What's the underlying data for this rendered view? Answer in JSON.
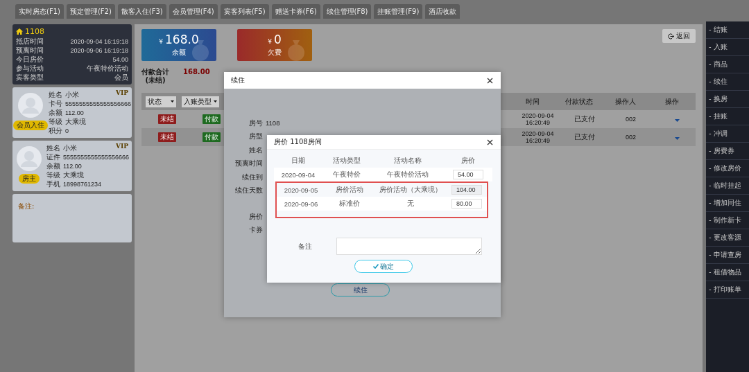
{
  "tabs": [
    {
      "label": "实时房态(F1)"
    },
    {
      "label": "预定管理(F2)"
    },
    {
      "label": "散客入住(F3)"
    },
    {
      "label": "会员管理(F4)"
    },
    {
      "label": "宾客列表(F5)"
    },
    {
      "label": "赠送卡券(F6)"
    },
    {
      "label": "续住管理(F8)"
    },
    {
      "label": "挂账管理(F9)"
    },
    {
      "label": "酒店收款"
    }
  ],
  "room": {
    "number": "1108",
    "fields": [
      {
        "label": "抵店时间",
        "value": "2020-09-04 16:19:18"
      },
      {
        "label": "预离时间",
        "value": "2020-09-06 16:19:18"
      },
      {
        "label": "今日房价",
        "value": "54.00"
      },
      {
        "label": "参与活动",
        "value": "午夜特价活动"
      },
      {
        "label": "宾客类型",
        "value": "会员"
      }
    ]
  },
  "guests": [
    {
      "vip": "VIP",
      "badge": "会员入住",
      "fields": [
        {
          "label": "姓名",
          "value": "小米"
        },
        {
          "label": "卡号",
          "value": "5555555555555556666"
        },
        {
          "label": "余额",
          "value": "112.00"
        },
        {
          "label": "等级",
          "value": "大乘境"
        },
        {
          "label": "积分",
          "value": "0"
        }
      ]
    },
    {
      "vip": "VIP",
      "badge": "房主",
      "fields": [
        {
          "label": "姓名",
          "value": "小米"
        },
        {
          "label": "证件",
          "value": "5555555555555556666"
        },
        {
          "label": "余额",
          "value": "112.00"
        },
        {
          "label": "等级",
          "value": "大乘境"
        },
        {
          "label": "手机",
          "value": "18998761234"
        }
      ]
    }
  ],
  "remark": {
    "label": "备注:"
  },
  "balances": [
    {
      "kind": "balance",
      "currency": "¥",
      "amount": "168.0",
      "label": "余额"
    },
    {
      "kind": "debt",
      "currency": "¥",
      "amount": "0",
      "label": "欠费"
    }
  ],
  "return_button": "返回",
  "payment_total": {
    "label_lines": [
      "付款合计",
      "(未结)"
    ],
    "amount": "168.00"
  },
  "filters": [
    "状态",
    "入账类型"
  ],
  "table": {
    "columns": [
      "时间",
      "付款状态",
      "操作人",
      "操作"
    ],
    "rows": [
      {
        "status": "未结",
        "type": "付款",
        "time": [
          "2020-09-04",
          "16:20:49"
        ],
        "pay_status": "已支付",
        "operator": "002"
      },
      {
        "status": "未结",
        "type": "付款",
        "time": [
          "2020-09-04",
          "16:20:49"
        ],
        "pay_status": "已支付",
        "operator": "002"
      }
    ]
  },
  "sidebar": {
    "items": [
      "- 结账",
      "- 入账",
      "- 商品",
      "- 续住",
      "- 换房",
      "- 挂账",
      "- 冲调",
      "- 房费券",
      "- 修改房价",
      "- 临时挂起",
      "- 增加同住",
      "- 制作新卡",
      "- 更改客源",
      "- 申请查房",
      "- 租借物品",
      "- 打印账单"
    ]
  },
  "extend_dialog": {
    "title": "续住",
    "fields": [
      {
        "label": "房号",
        "value": "1108"
      },
      {
        "label": "房型"
      },
      {
        "label": "姓名"
      },
      {
        "label": "预离时间"
      },
      {
        "label": "续住到"
      },
      {
        "label": "续住天数"
      }
    ],
    "price_fields": [
      {
        "label": "房价"
      },
      {
        "label": "卡券"
      }
    ],
    "submit": "续住"
  },
  "price_dialog": {
    "title": "房价 1108房间",
    "columns": [
      "日期",
      "活动类型",
      "活动名称",
      "房价"
    ],
    "rows": [
      {
        "date": "2020-09-04",
        "activity_type": "午夜特价",
        "activity_name": "午夜特价活动",
        "price": "54.00",
        "disabled": false,
        "highlighted": false
      },
      {
        "date": "2020-09-05",
        "activity_type": "房价活动",
        "activity_name": "房价活动（大乘境）",
        "price": "104.00",
        "disabled": true,
        "highlighted": true
      },
      {
        "date": "2020-09-06",
        "activity_type": "标准价",
        "activity_name": "无",
        "price": "80.00",
        "disabled": false,
        "highlighted": true
      }
    ],
    "remark_label": "备注",
    "confirm": "确定"
  }
}
